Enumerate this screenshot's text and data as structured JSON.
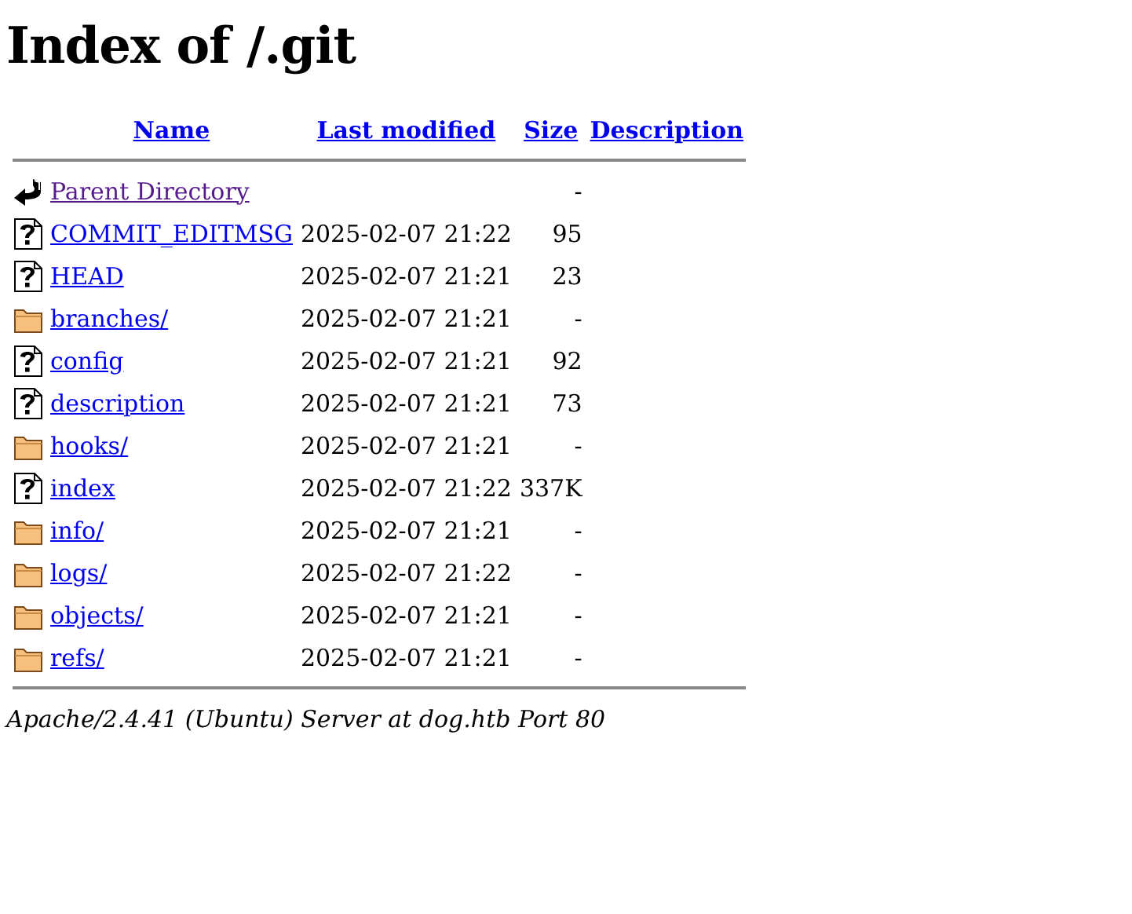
{
  "title": "Index of /.git",
  "columns": [
    "Name",
    "Last modified",
    "Size",
    "Description"
  ],
  "rows": [
    {
      "kind": "back",
      "name": "Parent Directory",
      "visited": true,
      "modified": "",
      "size": "-"
    },
    {
      "kind": "unknown",
      "name": "COMMIT_EDITMSG",
      "visited": false,
      "modified": "2025-02-07 21:22",
      "size": "95"
    },
    {
      "kind": "unknown",
      "name": "HEAD",
      "visited": false,
      "modified": "2025-02-07 21:21",
      "size": "23"
    },
    {
      "kind": "folder",
      "name": "branches/",
      "visited": false,
      "modified": "2025-02-07 21:21",
      "size": "-"
    },
    {
      "kind": "unknown",
      "name": "config",
      "visited": false,
      "modified": "2025-02-07 21:21",
      "size": "92"
    },
    {
      "kind": "unknown",
      "name": "description",
      "visited": false,
      "modified": "2025-02-07 21:21",
      "size": "73"
    },
    {
      "kind": "folder",
      "name": "hooks/",
      "visited": false,
      "modified": "2025-02-07 21:21",
      "size": "-"
    },
    {
      "kind": "unknown",
      "name": "index",
      "visited": false,
      "modified": "2025-02-07 21:22",
      "size": "337K"
    },
    {
      "kind": "folder",
      "name": "info/",
      "visited": false,
      "modified": "2025-02-07 21:21",
      "size": "-"
    },
    {
      "kind": "folder",
      "name": "logs/",
      "visited": false,
      "modified": "2025-02-07 21:22",
      "size": "-"
    },
    {
      "kind": "folder",
      "name": "objects/",
      "visited": false,
      "modified": "2025-02-07 21:21",
      "size": "-"
    },
    {
      "kind": "folder",
      "name": "refs/",
      "visited": false,
      "modified": "2025-02-07 21:21",
      "size": "-"
    }
  ],
  "footer": "Apache/2.4.41 (Ubuntu) Server at dog.htb Port 80"
}
